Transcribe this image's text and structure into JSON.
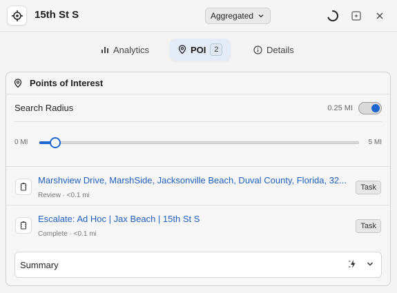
{
  "header": {
    "title": "15th St S",
    "brand_icon": "crosshair-icon",
    "mode_select": {
      "value": "Aggregated"
    },
    "icons": [
      "spinner-icon",
      "sparkle-square-icon",
      "close-icon"
    ]
  },
  "tabs": [
    {
      "label": "Analytics",
      "icon": "bar-chart-icon",
      "active": false
    },
    {
      "label": "POI",
      "icon": "map-pin-icon",
      "active": true,
      "count": "2"
    },
    {
      "label": "Details",
      "icon": "info-icon",
      "active": false
    }
  ],
  "panel": {
    "title": "Points of Interest",
    "icon": "map-pin-icon",
    "search_radius": {
      "label": "Search Radius",
      "value": "0.25 MI",
      "toggle_on": true,
      "min_label": "0 MI",
      "max_label": "5 MI",
      "fraction": 0.05
    },
    "poi_items": [
      {
        "title": "Marshview Drive, MarshSide, Jacksonville Beach, Duval County, Florida, 32...",
        "subtitle": "Review · <0.1 mi",
        "action": "Task"
      },
      {
        "title": "Escalate: Ad Hoc | Jax Beach | 15th St S",
        "subtitle": "Complete · <0.1 mi",
        "action": "Task"
      }
    ],
    "summary": {
      "label": "Summary"
    }
  },
  "colors": {
    "accent": "#1e66d0",
    "link": "#1f5fbf",
    "active_tab_bg": "#e3ecf6"
  }
}
